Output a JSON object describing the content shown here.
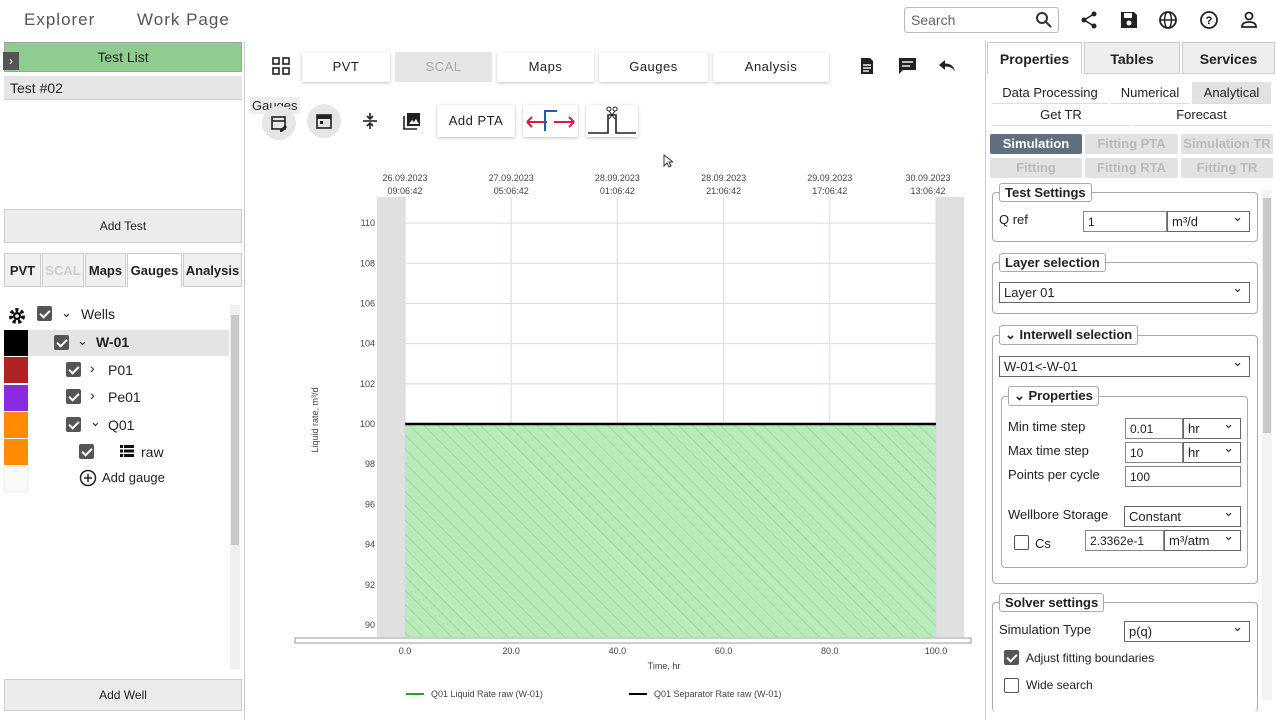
{
  "header": {
    "tabs": [
      "Explorer",
      "Work Page"
    ],
    "search_placeholder": "Search"
  },
  "left": {
    "test_list_title": "Test List",
    "test_item": "Test #02",
    "add_test": "Add Test",
    "tabs": [
      "PVT",
      "SCAL",
      "Maps",
      "Gauges",
      "Analysis"
    ],
    "tree": {
      "root": "Wells",
      "well": "W-01",
      "gauges": [
        "P01",
        "Pe01",
        "Q01"
      ],
      "raw": "raw",
      "add_gauge": "Add gauge"
    },
    "add_well": "Add Well",
    "swatch_colors": [
      "#000000",
      "#b22222",
      "#8a2be2",
      "#ff8c00",
      "#ff8c00"
    ]
  },
  "center": {
    "tabs": [
      "PVT",
      "SCAL",
      "Maps",
      "Gauges",
      "Analysis"
    ],
    "tooltip": "Gauges",
    "add_pta": "Add PTA"
  },
  "chart_data": {
    "type": "area",
    "top_axis_labels": [
      [
        "26.09.2023",
        "09:06:42"
      ],
      [
        "27.09.2023",
        "05:06:42"
      ],
      [
        "28.09.2023",
        "01:06:42"
      ],
      [
        "28.09.2023",
        "21:06:42"
      ],
      [
        "29.09.2023",
        "17:06:42"
      ],
      [
        "30.09.2023",
        "13:06:42"
      ]
    ],
    "x_ticks": [
      "0.0",
      "20.0",
      "40.0",
      "60.0",
      "80.0",
      "100.0"
    ],
    "y_ticks": [
      "90",
      "92",
      "94",
      "96",
      "98",
      "100",
      "102",
      "104",
      "106",
      "108",
      "110"
    ],
    "xlabel": "Time, hr",
    "ylabel": "Liquid rate, m³/d",
    "xlim": [
      0,
      100
    ],
    "ylim": [
      89.4,
      111.3
    ],
    "series": [
      {
        "name": "Q01 Liquid Rate raw (W-01)",
        "color": "#2e9e2e",
        "x": [
          0,
          100
        ],
        "y": [
          100,
          100
        ]
      },
      {
        "name": "Q01 Separator Rate raw (W-01)",
        "color": "#000000",
        "x": [
          0,
          100
        ],
        "y": [
          100,
          100
        ]
      }
    ],
    "legend": "bottom",
    "grid": true
  },
  "right": {
    "tabs": [
      "Properties",
      "Tables",
      "Services"
    ],
    "subtabs": [
      "Data Processing",
      "Numerical",
      "Analytical",
      "Get TR",
      "Forecast"
    ],
    "modes": [
      "Simulation",
      "Fitting PTA",
      "Simulation TR",
      "Fitting",
      "Fitting RTA",
      "Fitting TR"
    ],
    "test_settings": {
      "title": "Test Settings",
      "qref_label": "Q ref",
      "qref_value": "1",
      "qref_unit": "m³/d"
    },
    "layer": {
      "title": "Layer selection",
      "value": "Layer 01"
    },
    "interwell": {
      "title": "Interwell selection",
      "value": "W-01<-W-01"
    },
    "properties": {
      "title": "Properties",
      "min_label": "Min time step",
      "min_value": "0.01",
      "min_unit": "hr",
      "max_label": "Max time step",
      "max_value": "10",
      "max_unit": "hr",
      "ppc_label": "Points per cycle",
      "ppc_value": "100",
      "wbs_label": "Wellbore Storage",
      "wbs_value": "Constant",
      "cs_label": "Cs",
      "cs_value": "2.3362e-1",
      "cs_unit": "m³/atm"
    },
    "solver": {
      "title": "Solver settings",
      "type_label": "Simulation Type",
      "type_value": "p(q)",
      "adjust_label": "Adjust fitting boundaries",
      "wide_label": "Wide search"
    }
  }
}
